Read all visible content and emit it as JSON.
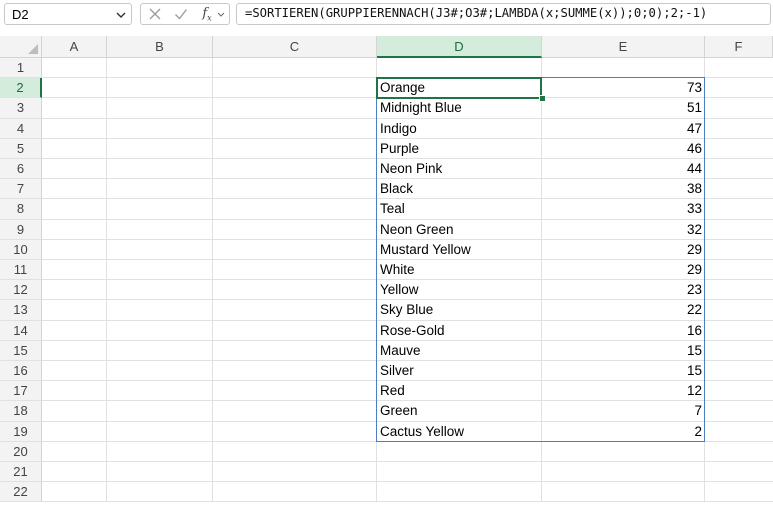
{
  "name_box": "D2",
  "formula_bar": {
    "formula": "=SORTIEREN(GRUPPIERENNACH(J3#;O3#;LAMBDA(x;SUMME(x));0;0);2;-1)",
    "cancel_icon": "close-icon",
    "enter_icon": "check-icon",
    "fx_label": "fx"
  },
  "columns": [
    "A",
    "B",
    "C",
    "D",
    "E",
    "F"
  ],
  "rows": [
    "1",
    "2",
    "3",
    "4",
    "5",
    "6",
    "7",
    "8",
    "9",
    "10",
    "11",
    "12",
    "13",
    "14",
    "15",
    "16",
    "17",
    "18",
    "19",
    "20",
    "21",
    "22"
  ],
  "selected_column": "D",
  "selected_row": "2",
  "cells": [
    {
      "name": "Orange",
      "value": "73"
    },
    {
      "name": "Midnight Blue",
      "value": "51"
    },
    {
      "name": "Indigo",
      "value": "47"
    },
    {
      "name": "Purple",
      "value": "46"
    },
    {
      "name": "Neon Pink",
      "value": "44"
    },
    {
      "name": "Black",
      "value": "38"
    },
    {
      "name": "Teal",
      "value": "33"
    },
    {
      "name": "Neon Green",
      "value": "32"
    },
    {
      "name": "Mustard Yellow",
      "value": "29"
    },
    {
      "name": "White",
      "value": "29"
    },
    {
      "name": "Yellow",
      "value": "23"
    },
    {
      "name": "Sky Blue",
      "value": "22"
    },
    {
      "name": "Rose-Gold",
      "value": "16"
    },
    {
      "name": "Mauve",
      "value": "15"
    },
    {
      "name": "Silver",
      "value": "15"
    },
    {
      "name": "Red",
      "value": "12"
    },
    {
      "name": "Green",
      "value": "7"
    },
    {
      "name": "Cactus Yellow",
      "value": "2"
    }
  ],
  "colors": {
    "selection_green": "#217346",
    "header_highlight": "#d3ecdb",
    "spill_border": "#4a7fc1"
  }
}
